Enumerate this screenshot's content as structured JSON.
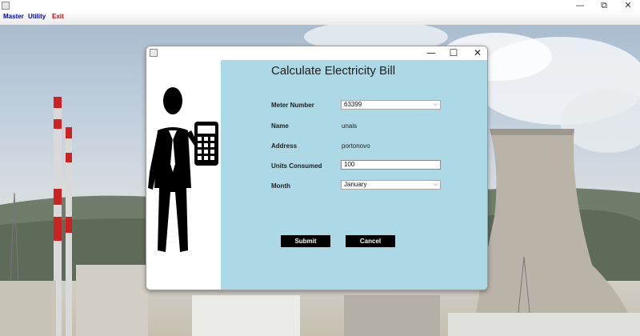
{
  "window": {
    "minimize": "—",
    "restore": "⧉",
    "close": "✕"
  },
  "menubar": {
    "items": [
      {
        "label": "Master",
        "color": "#0000cc"
      },
      {
        "label": "Utility",
        "color": "#0000cc"
      },
      {
        "label": "Exit",
        "color": "#dd0000"
      }
    ]
  },
  "dialog": {
    "minimize": "—",
    "maximize": "☐",
    "close": "✕",
    "heading": "Calculate Electricity Bill",
    "panel_color": "#add8e6",
    "fields": {
      "meter_number": {
        "label": "Meter Number",
        "value": "63399"
      },
      "name": {
        "label": "Name",
        "value": "unais"
      },
      "address": {
        "label": "Address",
        "value": "portonovo"
      },
      "units_consumed": {
        "label": "Units Consumed",
        "value": "100"
      },
      "month": {
        "label": "Month",
        "value": "January"
      }
    },
    "buttons": {
      "submit": "Submit",
      "cancel": "Cancel"
    },
    "illustration": "man-with-calculator-icon"
  }
}
